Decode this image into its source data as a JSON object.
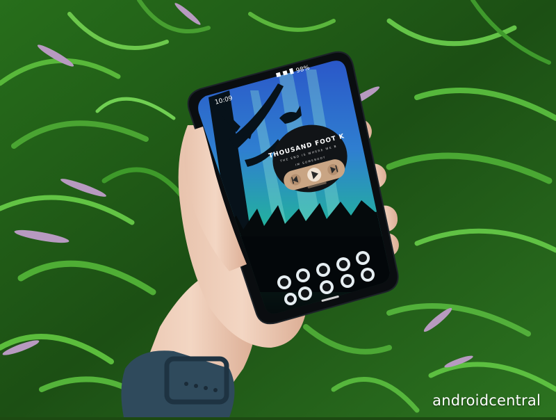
{
  "phone": {
    "status_bar": {
      "time": "10:09",
      "battery": "98%"
    },
    "now_playing": {
      "title": "THOUSAND FOOT K",
      "subtitle": "THE END IS WHERE WE B",
      "secondary": "IM SOMEBODY",
      "controls": [
        "previous",
        "play",
        "next"
      ]
    },
    "dock_icon_rows": [
      [
        "app-icon",
        "app-icon",
        "app-icon",
        "app-icon"
      ],
      [
        "app-icon",
        "app-icon",
        "app-icon",
        "app-icon",
        "app-icon"
      ]
    ]
  },
  "watermark": "androidcentral",
  "colors": {
    "grass": "#2f7a1e",
    "teal_glow": "#24b89a",
    "sky_blue": "#2f63d0",
    "widget_tan": "#c9a584",
    "watch_band": "#2f4a5c"
  }
}
